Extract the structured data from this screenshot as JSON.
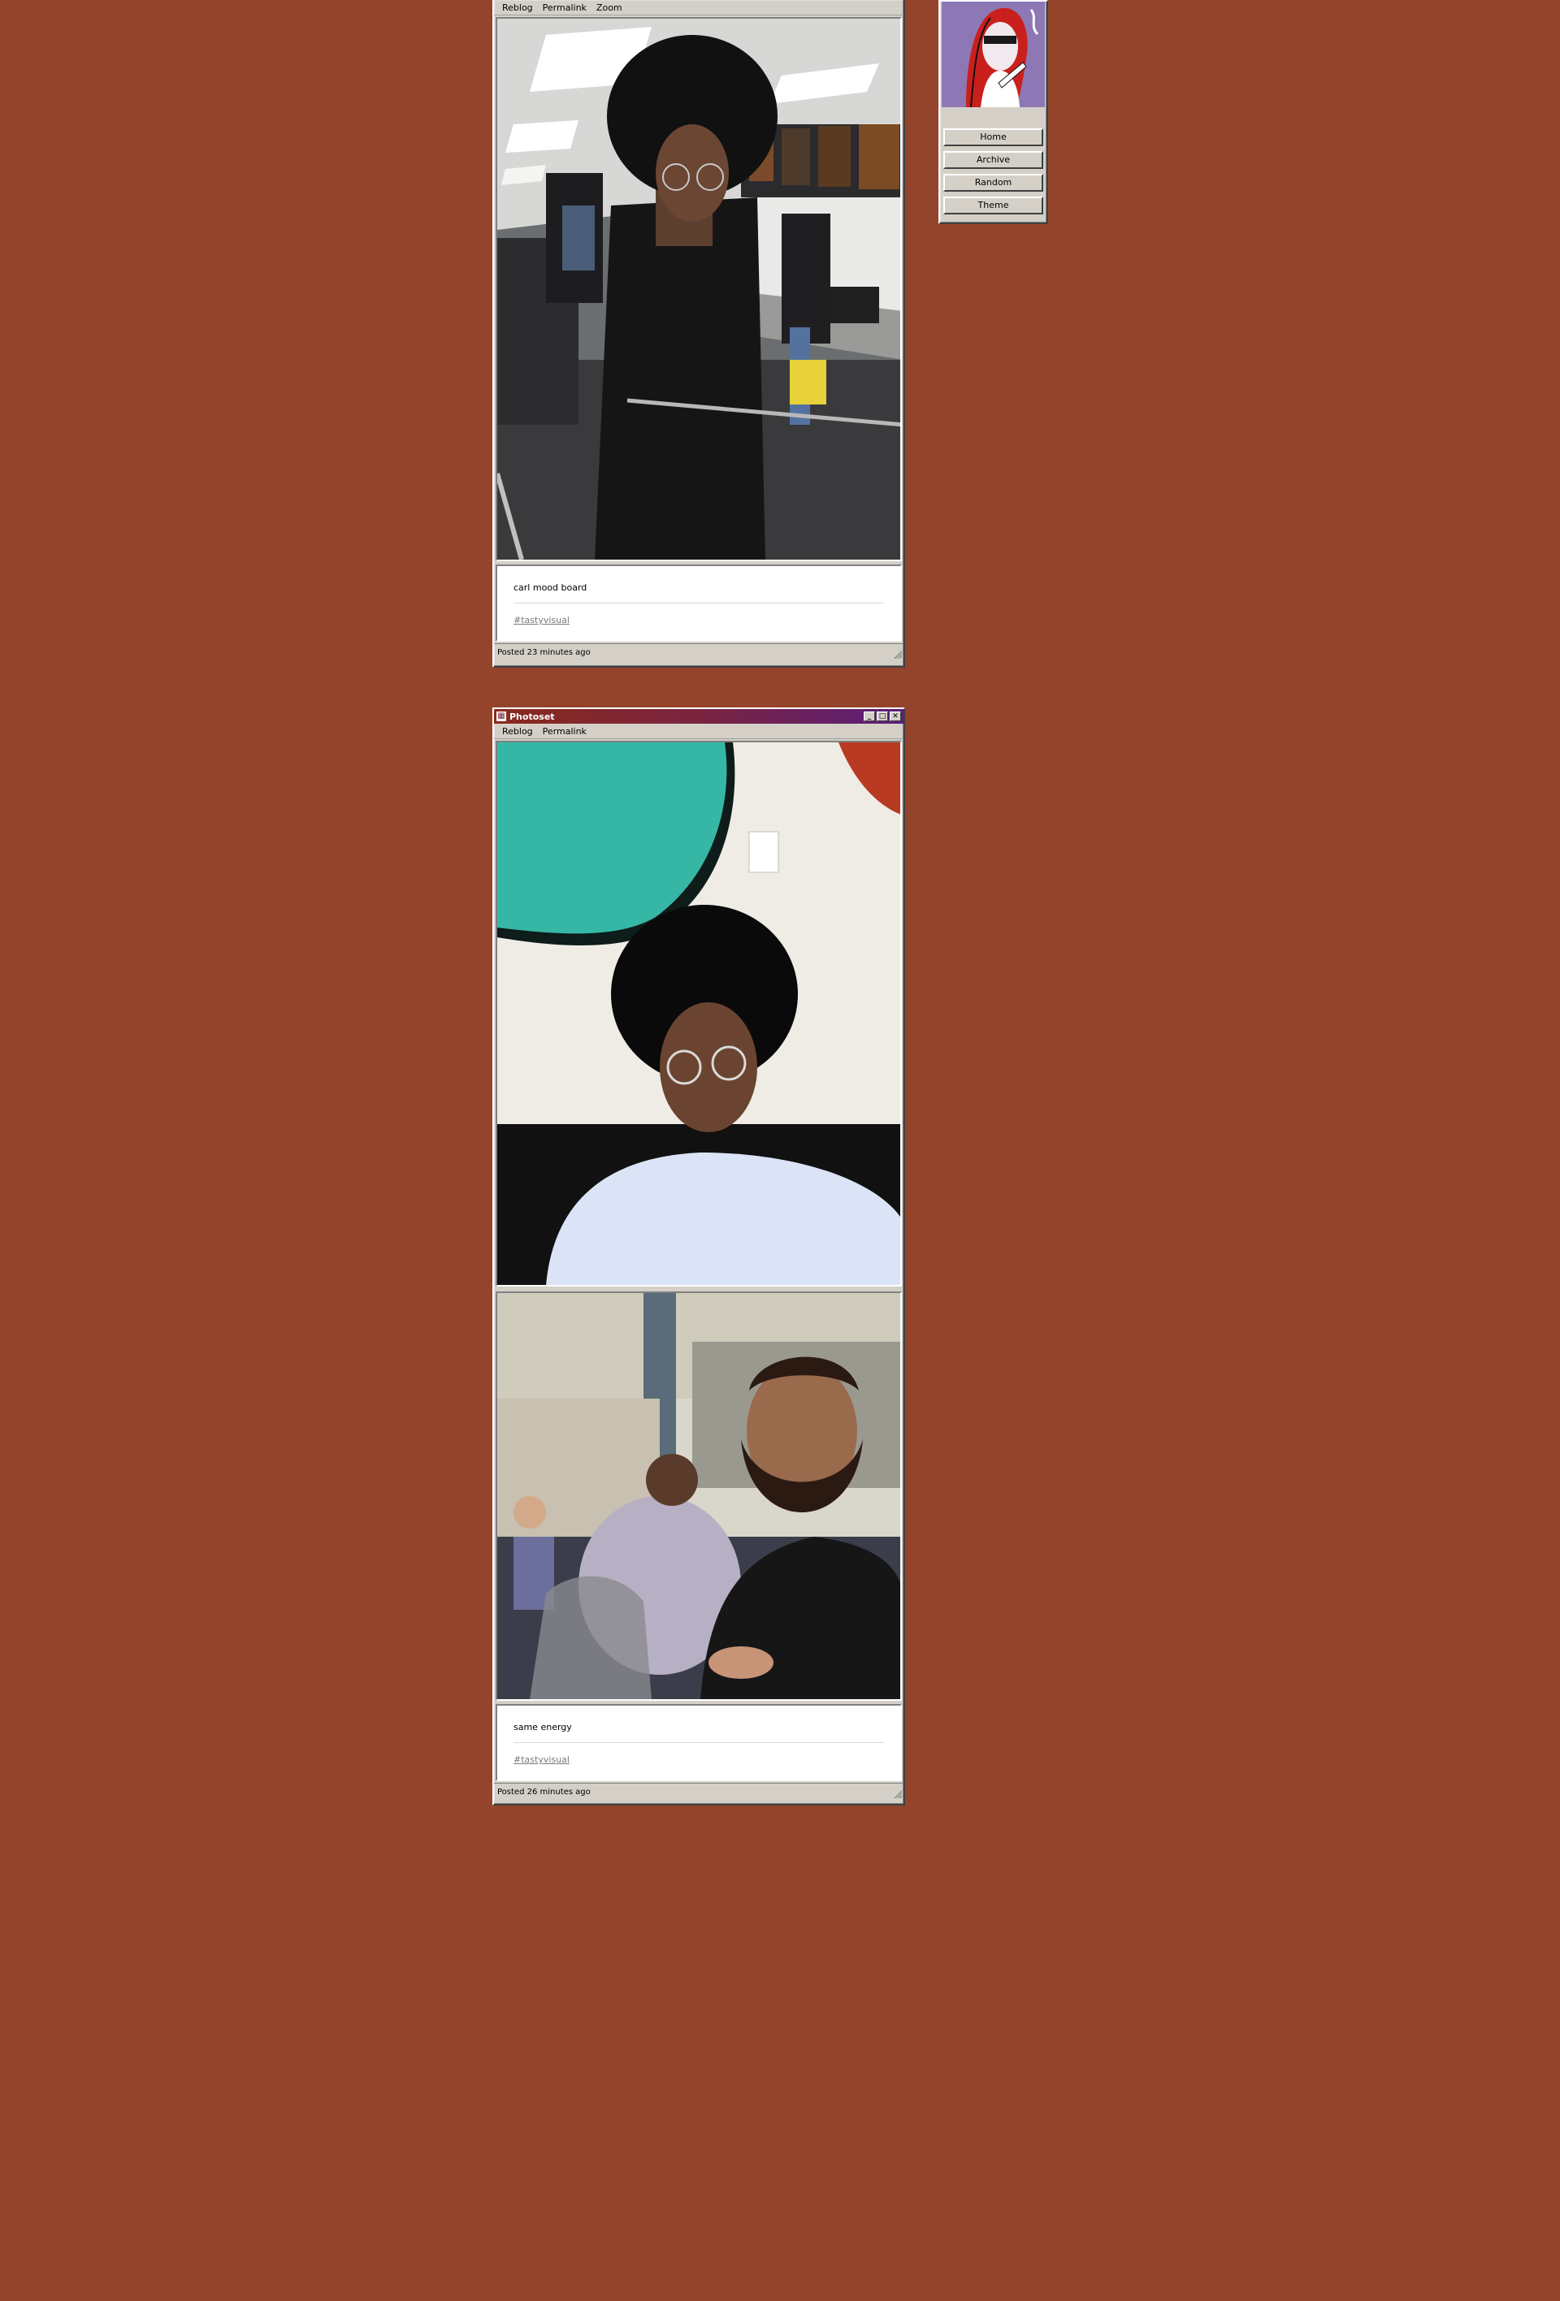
{
  "posts": [
    {
      "menu": {
        "reblog": "Reblog",
        "permalink": "Permalink",
        "zoom": "Zoom"
      },
      "caption": "carl mood board",
      "tag": "#tastyvisual",
      "posted": "Posted 23 minutes ago"
    },
    {
      "title": "Photoset",
      "menu": {
        "reblog": "Reblog",
        "permalink": "Permalink"
      },
      "caption": "same energy",
      "tag": "#tastyvisual",
      "posted": "Posted 26 minutes ago"
    }
  ],
  "sidebar": {
    "nav": [
      "Home",
      "Archive",
      "Random",
      "Theme"
    ]
  },
  "colors": {
    "background": "#95442c",
    "window_face": "#d4d0c8",
    "title_gradient_start": "#8a2a1c",
    "title_gradient_end": "#5b1d7a"
  }
}
